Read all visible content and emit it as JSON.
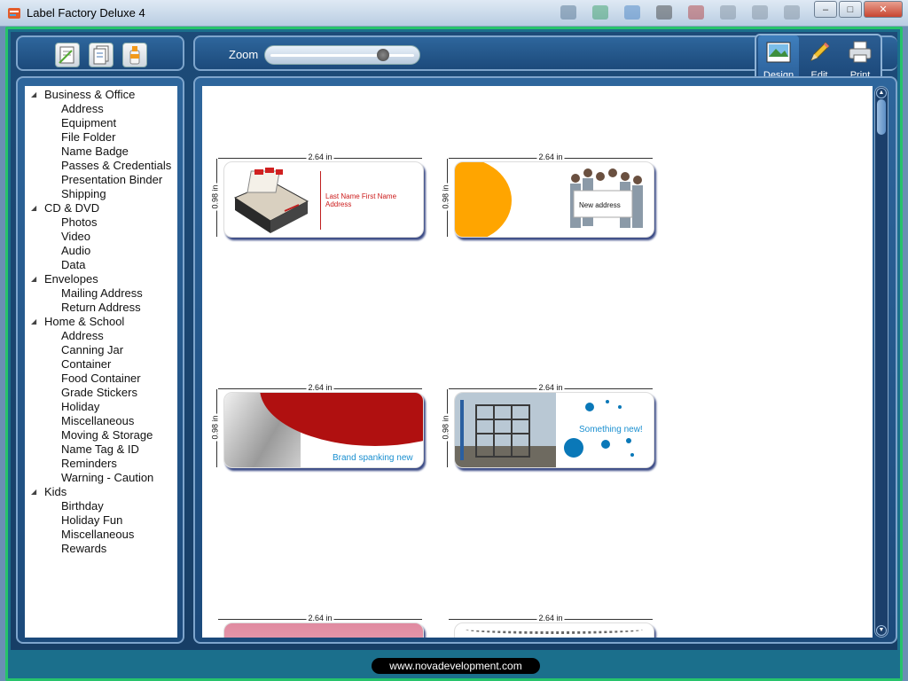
{
  "window": {
    "title": "Label Factory Deluxe 4",
    "minimize": "–",
    "maximize": "□",
    "close": "✕"
  },
  "toolbar": {
    "zoom_label": "Zoom",
    "zoom_value": 0.8
  },
  "modes": [
    {
      "label": "Design"
    },
    {
      "label": "Edit"
    },
    {
      "label": "Print"
    }
  ],
  "tree": {
    "categories": [
      {
        "label": "Business & Office",
        "items": [
          "Address",
          "Equipment",
          "File Folder",
          "Name Badge",
          "Passes & Credentials",
          "Presentation Binder",
          "Shipping"
        ]
      },
      {
        "label": "CD & DVD",
        "items": [
          "Photos",
          "Video",
          "Audio",
          "Data"
        ]
      },
      {
        "label": "Envelopes",
        "items": [
          "Mailing Address",
          "Return Address"
        ]
      },
      {
        "label": "Home & School",
        "items": [
          "Address",
          "Canning Jar",
          "Container",
          "Food Container",
          "Grade Stickers",
          "Holiday",
          "Miscellaneous",
          "Moving & Storage",
          "Name Tag & ID",
          "Reminders",
          "Warning - Caution"
        ]
      },
      {
        "label": "Kids",
        "items": [
          "Birthday",
          "Holiday Fun",
          "Miscellaneous",
          "Rewards"
        ]
      }
    ]
  },
  "labels": [
    {
      "width": "2.64 in",
      "height": "0.98 in",
      "text": "Last Name First Name Address",
      "text_color": "#cc1a1a"
    },
    {
      "width": "2.64 in",
      "height": "0.98 in",
      "text": "New address",
      "text_color": "#111111"
    },
    {
      "width": "2.64 in",
      "height": "0.98 in",
      "text": "Brand spanking new",
      "text_color": "#1a8fd0"
    },
    {
      "width": "2.64 in",
      "height": "0.98 in",
      "text": "Something new!",
      "text_color": "#1a8fd0"
    },
    {
      "width": "2.64 in",
      "height": "",
      "text": ""
    },
    {
      "width": "2.64 in",
      "height": "",
      "text": ""
    }
  ],
  "status": {
    "url": "www.novadevelopment.com"
  },
  "colors": {
    "frame_border": "#27c36b",
    "panel_bg": "#1c4a7b",
    "accent_orange": "#ffa500",
    "accent_red": "#b01010"
  }
}
